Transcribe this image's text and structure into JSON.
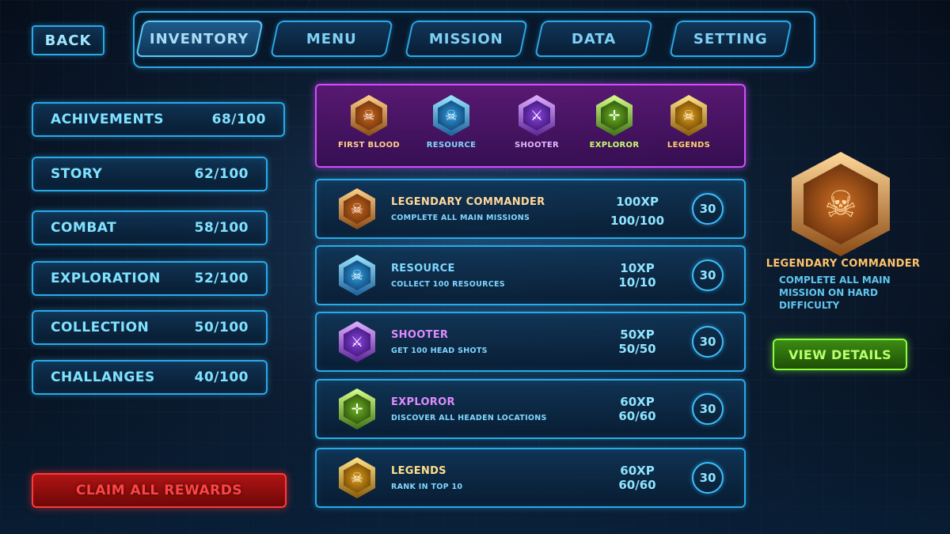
{
  "nav": {
    "back_label": "BACK",
    "tabs": [
      {
        "label": "INVENTORY",
        "active": true
      },
      {
        "label": "MENU"
      },
      {
        "label": "MISSION"
      },
      {
        "label": "DATA"
      },
      {
        "label": "SETTING"
      }
    ]
  },
  "categories": [
    {
      "label": "ACHIVEMENTS",
      "progress": "68/100"
    },
    {
      "label": "STORY",
      "progress": "62/100"
    },
    {
      "label": "COMBAT",
      "progress": "58/100"
    },
    {
      "label": "EXPLORATION",
      "progress": "52/100"
    },
    {
      "label": "COLLECTION",
      "progress": "50/100"
    },
    {
      "label": "CHALLANGES",
      "progress": "40/100"
    }
  ],
  "claim_label": "CLAIM ALL REWARDS",
  "badges": [
    {
      "label": "FIRST BLOOD",
      "icon": "trophy-skull-icon",
      "color": "#ffcf8a"
    },
    {
      "label": "RESOURCE",
      "icon": "blue-skull-icon",
      "color": "#7fd6ff"
    },
    {
      "label": "SHOOTER",
      "icon": "crossed-swords-icon",
      "color": "#e0b8ff"
    },
    {
      "label": "EXPLOROR",
      "icon": "crosshair-icon",
      "color": "#c8ff6a"
    },
    {
      "label": "LEGENDS",
      "icon": "gold-skull-icon",
      "color": "#ffd16a"
    }
  ],
  "achievements": [
    {
      "title": "LEGENDARY COMMANDER",
      "desc": "COMPLETE ALL MAIN MISSIONS",
      "xp": "100XP",
      "progress": "100/100",
      "reward": "30",
      "title_color": "#ffd89a",
      "icon": "trophy-skull-icon"
    },
    {
      "title": "RESOURCE",
      "desc": "COLLECT 100 RESOURCES",
      "xp": "10XP",
      "progress": "10/10",
      "reward": "30",
      "title_color": "#7fd6ff",
      "icon": "blue-skull-icon"
    },
    {
      "title": "SHOOTER",
      "desc": "GET 100 HEAD SHOTS",
      "xp": "50XP",
      "progress": "50/50",
      "reward": "30",
      "title_color": "#e08aff",
      "icon": "crossed-swords-icon"
    },
    {
      "title": "EXPLOROR",
      "desc": "DISCOVER ALL HEADEN LOCATIONS",
      "xp": "60XP",
      "progress": "60/60",
      "reward": "30",
      "title_color": "#e08aff",
      "icon": "crosshair-icon"
    },
    {
      "title": "LEGENDS",
      "desc": "RANK IN TOP 10",
      "xp": "60XP",
      "progress": "60/60",
      "reward": "30",
      "title_color": "#ffe08a",
      "icon": "gold-skull-icon"
    }
  ],
  "detail": {
    "title": "LEGENDARY COMMANDER",
    "desc": "COMPLETE ALL MAIN MISSION ON HARD DIFFICULTY",
    "button_label": "VIEW DETAILS",
    "icon": "trophy-skull-icon"
  }
}
